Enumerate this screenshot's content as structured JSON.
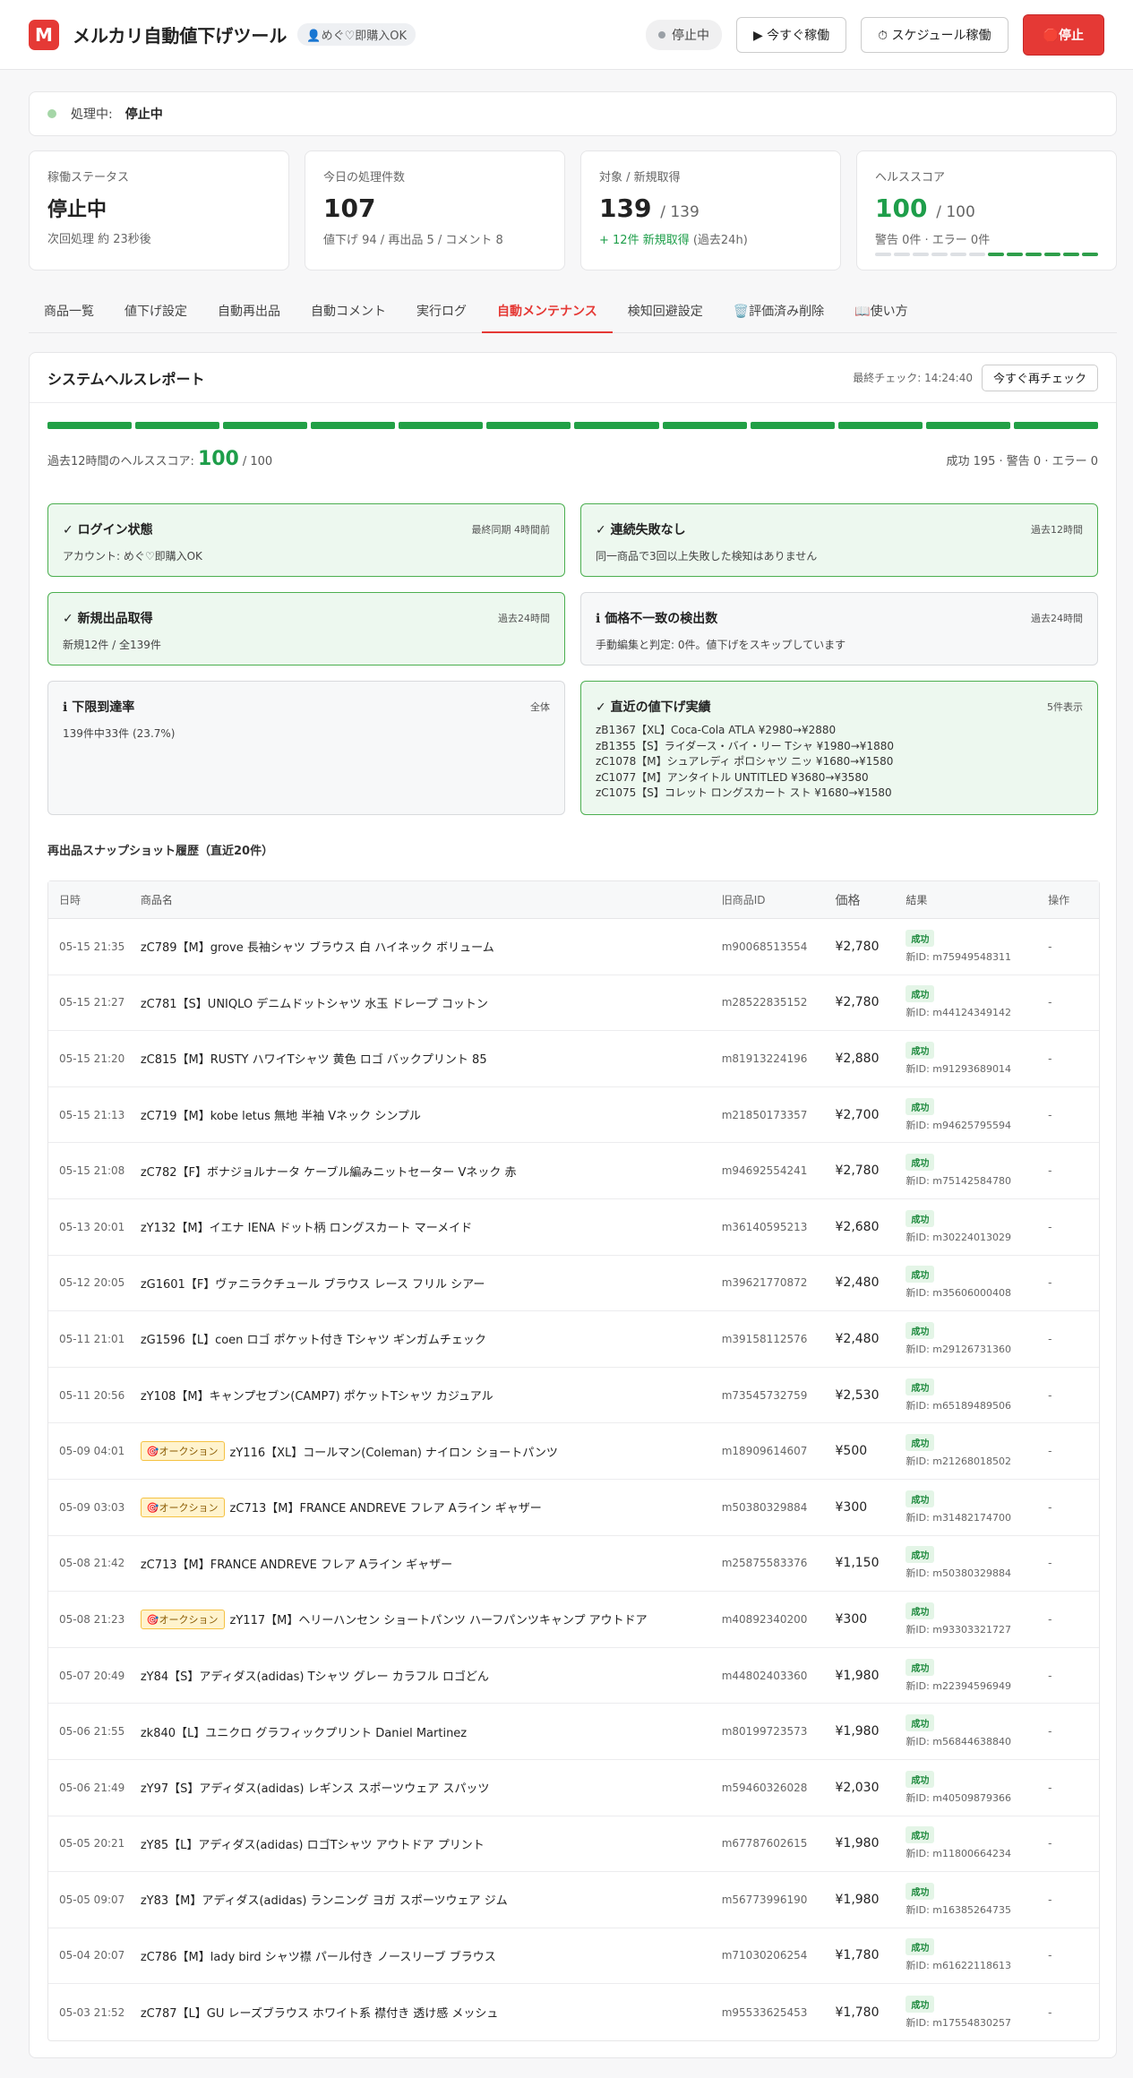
{
  "header": {
    "logo": "M",
    "title": "メルカリ自動値下げツール",
    "account": "👤めぐ♡即購入OK",
    "status": "停止中",
    "run_now": "▶ 今すぐ稼働",
    "schedule": "⏱ スケジュール稼働",
    "stop": "🛑停止"
  },
  "processing": {
    "label": "処理中:",
    "value": "停止中"
  },
  "stats": {
    "status": {
      "label": "稼働ステータス",
      "value": "停止中",
      "note": "次回処理 約 23秒後"
    },
    "today": {
      "label": "今日の処理件数",
      "value": "107",
      "note": "値下げ 94 / 再出品 5 / コメント 8"
    },
    "targets": {
      "label": "対象 / 新規取得",
      "value": "139",
      "total": "/ 139",
      "new_count": "+ 12件 新規取得",
      "new_period": "(過去24h)"
    },
    "health": {
      "label": "ヘルススコア",
      "value": "100",
      "max": "/ 100",
      "note": "警告 0件 · エラー 0件",
      "level": 0.5
    }
  },
  "tabs": [
    "商品一覧",
    "値下げ設定",
    "自動再出品",
    "自動コメント",
    "実行ログ",
    "自動メンテナンス",
    "検知回避設定",
    "🗑️評価済み削除",
    "📖使い方"
  ],
  "active_tab": 5,
  "report": {
    "title": "システムヘルスレポート",
    "last_check": "最終チェック: 14:24:40",
    "recheck": "今すぐ再チェック",
    "score_label": "過去12時間のヘルススコア:",
    "score": "100",
    "score_max": "/ 100",
    "counts": "成功 195 · 警告 0 · エラー 0",
    "segments": 12
  },
  "cards": {
    "login": {
      "title": "✓ ログイン状態",
      "meta": "最終同期 4時間前",
      "body": "アカウント: めぐ♡即購入OK"
    },
    "failures": {
      "title": "✓ 連続失敗なし",
      "meta": "過去12時間",
      "body": "同一商品で3回以上失敗した検知はありません"
    },
    "new_listings": {
      "title": "✓ 新規出品取得",
      "meta": "過去24時間",
      "body": "新規12件 / 全139件"
    },
    "price_mismatch": {
      "title": "ℹ 価格不一致の検出数",
      "meta": "過去24時間",
      "body": "手動編集と判定: 0件。値下げをスキップしています"
    },
    "floor": {
      "title": "ℹ 下限到達率",
      "meta": "全体",
      "body": "139件中33件 (23.7%)"
    },
    "recent": {
      "title": "✓ 直近の値下げ実績",
      "meta": "5件表示",
      "items": [
        "zB1367【XL】Coca-Cola ATLA ¥2980→¥2880",
        "zB1355【S】ライダース・バイ・リー Tシャ ¥1980→¥1880",
        "zC1078【M】シュアレディ ポロシャツ ニッ ¥1680→¥1580",
        "zC1077【M】アンタイトル UNTITLED ¥3680→¥3580",
        "zC1075【S】コレット ロングスカート スト ¥1680→¥1580"
      ]
    }
  },
  "snapshot": {
    "title": "再出品スナップショット履歴（直近20件）",
    "columns": [
      "日時",
      "商品名",
      "旧商品ID",
      "価格",
      "結果",
      "操作"
    ],
    "auction_label": "🎯オークション",
    "success_label": "成功",
    "new_id_prefix": "新ID: ",
    "rows": [
      {
        "date": "05-15 21:35",
        "name": "zC789【M】grove 長袖シャツ ブラウス 白 ハイネック ボリューム",
        "old_id": "m90068513554",
        "price": "¥2,780",
        "new_id": "m75949548311",
        "auction": false,
        "op": "-"
      },
      {
        "date": "05-15 21:27",
        "name": "zC781【S】UNIQLO デニムドットシャツ 水玉 ドレープ コットン",
        "old_id": "m28522835152",
        "price": "¥2,780",
        "new_id": "m44124349142",
        "auction": false,
        "op": "-"
      },
      {
        "date": "05-15 21:20",
        "name": "zC815【M】RUSTY ハワイTシャツ 黄色 ロゴ バックプリント 85",
        "old_id": "m81913224196",
        "price": "¥2,880",
        "new_id": "m91293689014",
        "auction": false,
        "op": "-"
      },
      {
        "date": "05-15 21:13",
        "name": "zC719【M】kobe letus 無地 半袖 Vネック シンプル",
        "old_id": "m21850173357",
        "price": "¥2,700",
        "new_id": "m94625795594",
        "auction": false,
        "op": "-"
      },
      {
        "date": "05-15 21:08",
        "name": "zC782【F】ボナジョルナータ ケーブル編みニットセーター Vネック 赤",
        "old_id": "m94692554241",
        "price": "¥2,780",
        "new_id": "m75142584780",
        "auction": false,
        "op": "-"
      },
      {
        "date": "05-13 20:01",
        "name": "zY132【M】イエナ IENA ドット柄 ロングスカート マーメイド",
        "old_id": "m36140595213",
        "price": "¥2,680",
        "new_id": "m30224013029",
        "auction": false,
        "op": "-"
      },
      {
        "date": "05-12 20:05",
        "name": "zG1601【F】ヴァニラクチュール ブラウス レース フリル シアー",
        "old_id": "m39621770872",
        "price": "¥2,480",
        "new_id": "m35606000408",
        "auction": false,
        "op": "-"
      },
      {
        "date": "05-11 21:01",
        "name": "zG1596【L】coen ロゴ ポケット付き Tシャツ ギンガムチェック",
        "old_id": "m39158112576",
        "price": "¥2,480",
        "new_id": "m29126731360",
        "auction": false,
        "op": "-"
      },
      {
        "date": "05-11 20:56",
        "name": "zY108【M】キャンプセブン(CAMP7) ポケットTシャツ カジュアル",
        "old_id": "m73545732759",
        "price": "¥2,530",
        "new_id": "m65189489506",
        "auction": false,
        "op": "-"
      },
      {
        "date": "05-09 04:01",
        "name": "zY116【XL】コールマン(Coleman) ナイロン ショートパンツ",
        "old_id": "m18909614607",
        "price": "¥500",
        "new_id": "m21268018502",
        "auction": true,
        "op": "-"
      },
      {
        "date": "05-09 03:03",
        "name": "zC713【M】FRANCE ANDREVE フレア Aライン ギャザー",
        "old_id": "m50380329884",
        "price": "¥300",
        "new_id": "m31482174700",
        "auction": true,
        "op": "-"
      },
      {
        "date": "05-08 21:42",
        "name": "zC713【M】FRANCE ANDREVE フレア Aライン ギャザー",
        "old_id": "m25875583376",
        "price": "¥1,150",
        "new_id": "m50380329884",
        "auction": false,
        "op": "-"
      },
      {
        "date": "05-08 21:23",
        "name": "zY117【M】ヘリーハンセン ショートパンツ ハーフパンツキャンプ アウトドア",
        "old_id": "m40892340200",
        "price": "¥300",
        "new_id": "m93303321727",
        "auction": true,
        "op": "-"
      },
      {
        "date": "05-07 20:49",
        "name": "zY84【S】アディダス(adidas) Tシャツ グレー カラフル ロゴどん",
        "old_id": "m44802403360",
        "price": "¥1,980",
        "new_id": "m22394596949",
        "auction": false,
        "op": "-"
      },
      {
        "date": "05-06 21:55",
        "name": "zk840【L】ユニクロ グラフィックプリント Daniel Martinez",
        "old_id": "m80199723573",
        "price": "¥1,980",
        "new_id": "m56844638840",
        "auction": false,
        "op": "-"
      },
      {
        "date": "05-06 21:49",
        "name": "zY97【S】アディダス(adidas) レギンス スポーツウェア スパッツ",
        "old_id": "m59460326028",
        "price": "¥2,030",
        "new_id": "m40509879366",
        "auction": false,
        "op": "-"
      },
      {
        "date": "05-05 20:21",
        "name": "zY85【L】アディダス(adidas) ロゴTシャツ アウトドア プリント",
        "old_id": "m67787602615",
        "price": "¥1,980",
        "new_id": "m11800664234",
        "auction": false,
        "op": "-"
      },
      {
        "date": "05-05 09:07",
        "name": "zY83【M】アディダス(adidas) ランニング ヨガ スポーツウェア ジム",
        "old_id": "m56773996190",
        "price": "¥1,980",
        "new_id": "m16385264735",
        "auction": false,
        "op": "-"
      },
      {
        "date": "05-04 20:07",
        "name": "zC786【M】lady bird シャツ襟 パール付き ノースリーブ ブラウス",
        "old_id": "m71030206254",
        "price": "¥1,780",
        "new_id": "m61622118613",
        "auction": false,
        "op": "-"
      },
      {
        "date": "05-03 21:52",
        "name": "zC787【L】GU レーズブラウス ホワイト系 襟付き 透け感 メッシュ",
        "old_id": "m95533625453",
        "price": "¥1,780",
        "new_id": "m17554830257",
        "auction": false,
        "op": "-"
      }
    ]
  }
}
